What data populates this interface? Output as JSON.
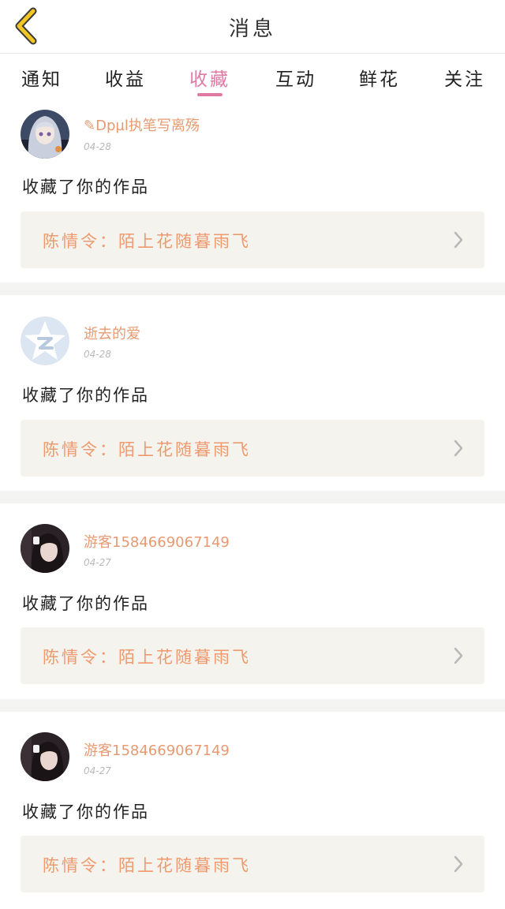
{
  "header": {
    "title": "消息"
  },
  "tabs": [
    {
      "label": "通知"
    },
    {
      "label": "收益"
    },
    {
      "label": "收藏"
    },
    {
      "label": "互动"
    },
    {
      "label": "鲜花"
    },
    {
      "label": "关注"
    }
  ],
  "active_tab": "收藏",
  "colors": {
    "accent": "#e07aa5",
    "username": "#e79a72",
    "work_title": "#ef9a6e",
    "work_box_bg": "#f4f3ee",
    "separator": "#f4f4f2"
  },
  "messages": [
    {
      "user": "✎Dpµl执笔写离殇",
      "date": "04-28",
      "action": "收藏了你的作品",
      "work": "陈情令：陌上花随暮雨飞",
      "avatar": "anime-avatar"
    },
    {
      "user": "逝去的爱",
      "date": "04-28",
      "action": "收藏了你的作品",
      "work": "陈情令：陌上花随暮雨飞",
      "avatar": "default-qq-avatar"
    },
    {
      "user": "游客1584669067149",
      "date": "04-27",
      "action": "收藏了你的作品",
      "work": "陈情令：陌上花随暮雨飞",
      "avatar": "photo-avatar"
    },
    {
      "user": "游客1584669067149",
      "date": "04-27",
      "action": "收藏了你的作品",
      "work": "陈情令：陌上花随暮雨飞",
      "avatar": "photo-avatar"
    }
  ]
}
